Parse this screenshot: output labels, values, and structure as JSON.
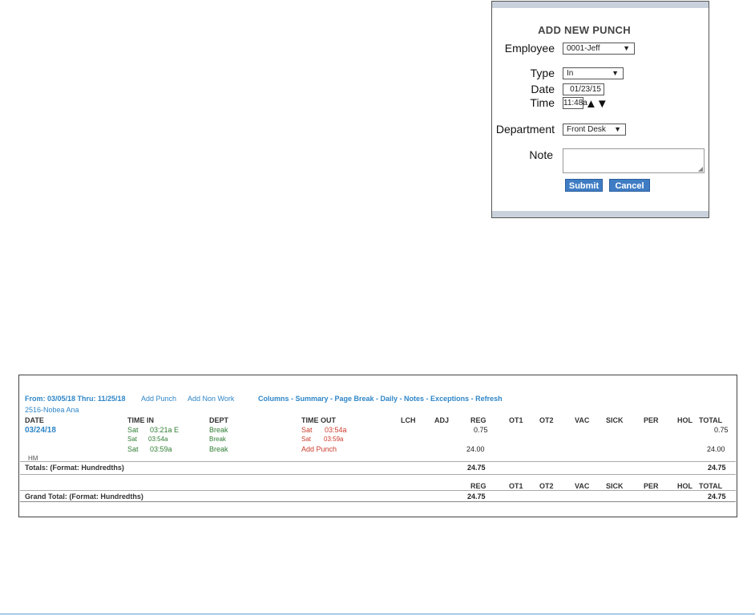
{
  "dialog": {
    "title": "ADD NEW PUNCH",
    "employee_label": "Employee",
    "employee_value": "0001-Jeff",
    "type_label": "Type",
    "type_value": "In",
    "date_label": "Date",
    "date_value": "01/23/15",
    "time_label": "Time",
    "time_value": "11:48a",
    "department_label": "Department",
    "department_value": "Front Desk",
    "note_label": "Note",
    "submit_label": "Submit",
    "cancel_label": "Cancel"
  },
  "timecard": {
    "range": "From: 03/05/18 Thru: 11/25/18",
    "add_punch": "Add Punch",
    "add_non_work": "Add Non Work",
    "toolbar": "Columns - Summary - Page Break - Daily - Notes - Exceptions - Refresh",
    "employee": "2516-Nobea Ana",
    "columns": [
      "DATE",
      "TIME IN",
      "DEPT",
      "TIME OUT",
      "LCH",
      "ADJ",
      "REG",
      "OT1",
      "OT2",
      "VAC",
      "SICK",
      "PER",
      "HOL",
      "TOTAL"
    ],
    "date": "03/24/18",
    "rows": [
      {
        "in_day": "Sat",
        "in_time": "03:21a E",
        "dept": "Break",
        "out_day": "Sat",
        "out_time": "03:54a",
        "reg": "0.75",
        "total": "0.75"
      },
      {
        "in_day": "Sat",
        "in_time": "03:54a",
        "dept": "Break",
        "out_day": "Sat",
        "out_time": "03:59a",
        "reg": "",
        "total": ""
      },
      {
        "in_day": "Sat",
        "in_time": "03:59a",
        "dept": "Break",
        "out_add_punch": "Add Punch",
        "reg": "24.00",
        "total": "24.00"
      }
    ],
    "hm": "HM",
    "totals_label": "Totals: (Format: Hundredths)",
    "totals_reg": "24.75",
    "totals_total": "24.75",
    "grand_columns": [
      "REG",
      "OT1",
      "OT2",
      "VAC",
      "SICK",
      "PER",
      "HOL",
      "TOTAL"
    ],
    "grand_label": "Grand Total: (Format: Hundredths)",
    "grand_reg": "24.75",
    "grand_total": "24.75"
  }
}
